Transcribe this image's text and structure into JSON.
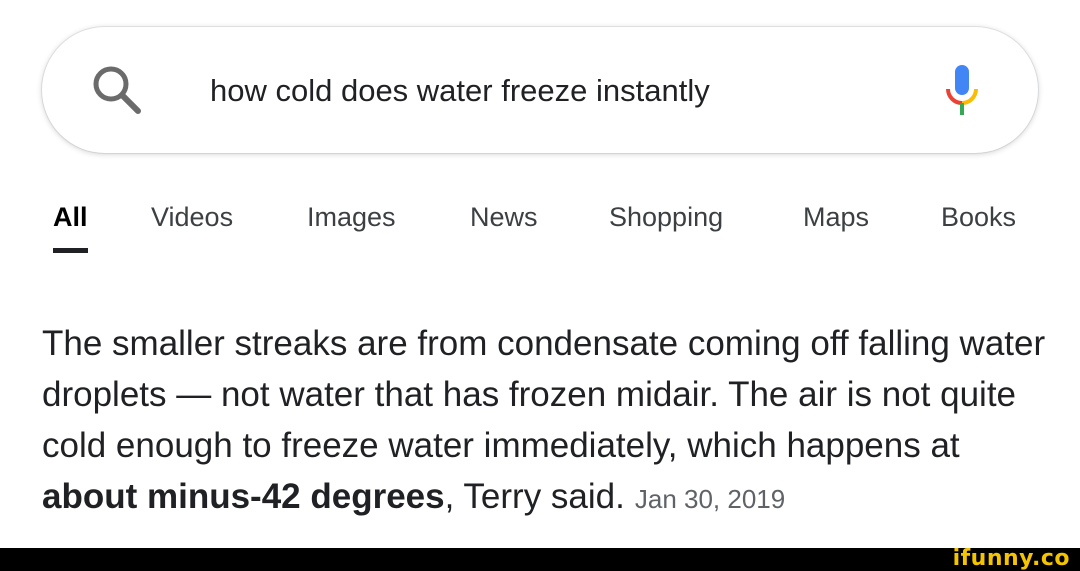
{
  "search": {
    "query": "how cold does water freeze instantly",
    "search_icon": "search-icon",
    "mic_icon": "microphone-icon"
  },
  "tabs": [
    {
      "label": "All",
      "active": true
    },
    {
      "label": "Videos"
    },
    {
      "label": "Images"
    },
    {
      "label": "News"
    },
    {
      "label": "Shopping"
    },
    {
      "label": "Maps"
    },
    {
      "label": "Books"
    }
  ],
  "snippet": {
    "text_before": "The smaller streaks are from condensate coming off falling water droplets — not water that has frozen midair. The air is not quite cold enough to freeze water immediately, which happens at ",
    "bold_text": "about minus-42 degrees",
    "text_after": ", Terry said.",
    "date": "Jan 30, 2019"
  },
  "watermark": "ifunny.co",
  "colors": {
    "mic_blue": "#4285F4",
    "mic_red": "#EA4335",
    "mic_yellow": "#FBBC04",
    "mic_green": "#34A853",
    "watermark": "#f5c400"
  }
}
